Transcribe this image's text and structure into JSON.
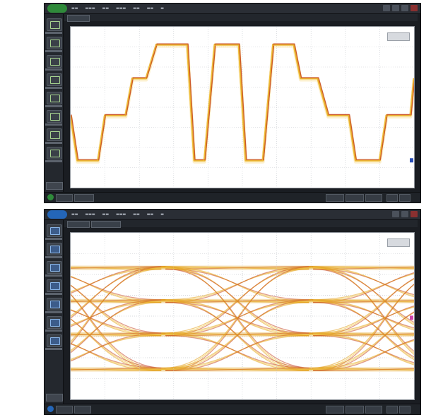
{
  "page": {
    "background": "#ffffff"
  },
  "colors": {
    "trace_orange": "#e3a01b",
    "trace_red": "#c7482a",
    "trace_yellow": "#f2c53d",
    "grid": "#c9ccd1",
    "chassis": "#1a1d22",
    "top_logo": "#2f8a3a",
    "bottom_logo": "#2466b8",
    "channel_marker": "#2a4fb8",
    "bottom_channel_marker": "#cc44aa"
  },
  "top_scope": {
    "view": "PAM4 waveform (time domain)",
    "sidebar_icons": [
      "setup-icon",
      "trigger-icon",
      "measure-icon",
      "math-icon",
      "cursor-icon",
      "zoom-icon",
      "analysis-icon",
      "utility-icon"
    ],
    "grid": {
      "cols": 10,
      "rows": 8
    },
    "levels": {
      "l0": 0.83,
      "l1": 0.55,
      "l2": 0.32,
      "l3": 0.11
    },
    "waveform_steps": [
      [
        "l1",
        0.0
      ],
      [
        "l0",
        0.02
      ],
      [
        "l0",
        0.08
      ],
      [
        "l1",
        0.1
      ],
      [
        "l1",
        0.16
      ],
      [
        "l2",
        0.18
      ],
      [
        "l2",
        0.22
      ],
      [
        "l3",
        0.25
      ],
      [
        "l3",
        0.34
      ],
      [
        "l0",
        0.36
      ],
      [
        "l0",
        0.39
      ],
      [
        "l3",
        0.42
      ],
      [
        "l3",
        0.49
      ],
      [
        "l0",
        0.51
      ],
      [
        "l0",
        0.56
      ],
      [
        "l3",
        0.59
      ],
      [
        "l3",
        0.65
      ],
      [
        "l2",
        0.67
      ],
      [
        "l2",
        0.72
      ],
      [
        "l1",
        0.75
      ],
      [
        "l1",
        0.81
      ],
      [
        "l0",
        0.83
      ],
      [
        "l0",
        0.9
      ],
      [
        "l1",
        0.92
      ],
      [
        "l1",
        0.99
      ],
      [
        "l2",
        1.0
      ]
    ]
  },
  "bottom_scope": {
    "view": "PAM4 eye diagram",
    "sidebar_icons": [
      "eye-setup-icon",
      "eye-mask-icon",
      "jitter-icon",
      "noise-icon",
      "histogram-icon",
      "pam-analysis-icon",
      "export-icon"
    ],
    "grid": {
      "cols": 10,
      "rows": 8
    },
    "eye_levels": [
      0.21,
      0.41,
      0.61,
      0.82
    ],
    "eye_crossings": [
      0.27,
      0.7
    ]
  }
}
